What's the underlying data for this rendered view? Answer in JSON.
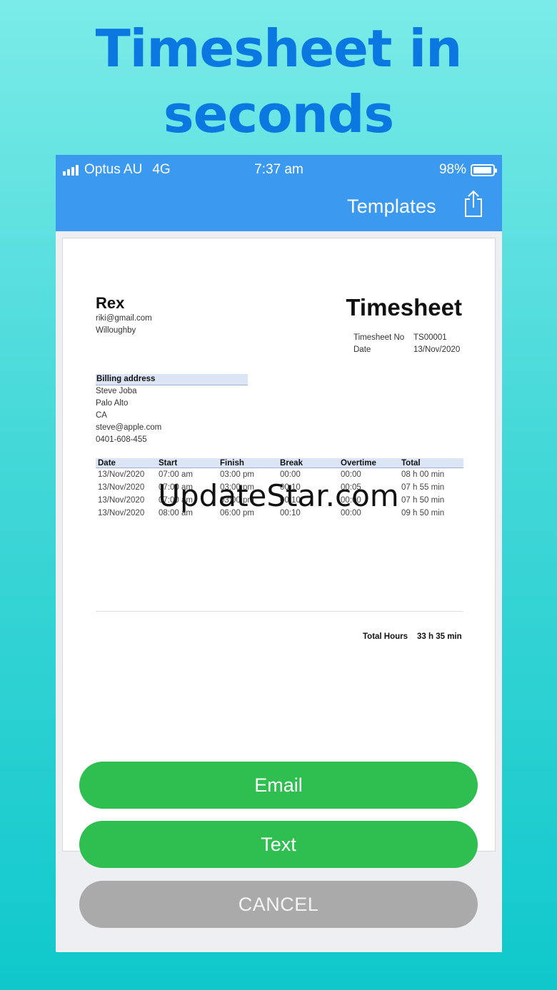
{
  "headline": {
    "line1": "Timesheet in",
    "line2": "seconds"
  },
  "status_bar": {
    "carrier": "Optus AU",
    "network": "4G",
    "time": "7:37 am",
    "battery": "98%",
    "battery_level": 0.98
  },
  "nav": {
    "templates_label": "Templates",
    "share_icon": "share-icon"
  },
  "document": {
    "from": {
      "name": "Rex",
      "email": "riki@gmail.com",
      "city": "Willoughby"
    },
    "title": "Timesheet",
    "meta": [
      {
        "label": "Timesheet No",
        "value": "TS00001"
      },
      {
        "label": "Date",
        "value": "13/Nov/2020"
      }
    ],
    "billing": {
      "heading": "Billing address",
      "lines": [
        "Steve Joba",
        "Palo Alto",
        "CA",
        "steve@apple.com",
        "0401-608-455"
      ]
    },
    "table": {
      "headers": [
        "Date",
        "Start",
        "Finish",
        "Break",
        "Overtime",
        "Total"
      ],
      "rows": [
        [
          "13/Nov/2020",
          "07:00 am",
          "03:00 pm",
          "00:00",
          "00:00",
          "08 h 00 min"
        ],
        [
          "13/Nov/2020",
          "07:00 am",
          "03:00 pm",
          "00:10",
          "00:05",
          "07 h 55 min"
        ],
        [
          "13/Nov/2020",
          "07:00 am",
          "03:00 pm",
          "00:10",
          "00:00",
          "07 h 50 min"
        ],
        [
          "13/Nov/2020",
          "08:00 am",
          "06:00 pm",
          "00:10",
          "00:00",
          "09 h 50 min"
        ]
      ]
    },
    "total": {
      "label": "Total Hours",
      "value": "33 h 35 min"
    }
  },
  "watermark": "UpdateStar.com",
  "actions": {
    "email": "Email",
    "text": "Text",
    "cancel": "CANCEL"
  }
}
